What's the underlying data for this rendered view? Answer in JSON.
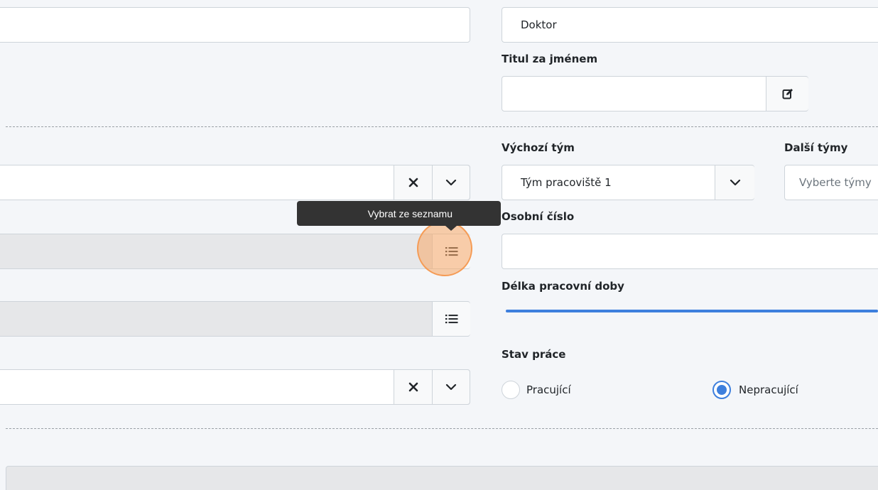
{
  "form": {
    "degree_before_value": "Doktor",
    "degree_after_label": "Titul za jménem",
    "degree_after_value": "",
    "default_team_label": "Výchozí tým",
    "default_team_value": "Tým pracoviště 1",
    "other_teams_label": "Další týmy",
    "other_teams_placeholder": "Vyberte týmy",
    "personal_number_label": "Osobní číslo",
    "personal_number_value": "",
    "work_length_label": "Délka pracovní doby",
    "work_length_fill_percent": 100,
    "work_status_label": "Stav práce",
    "work_status_options": [
      "Pracující",
      "Nepracující"
    ],
    "work_status_selected": "Nepracující"
  },
  "tooltip": {
    "text": "Vybrat ze seznamu"
  },
  "colors": {
    "accent": "#3d7fdd",
    "highlight": "#f59b55",
    "tooltip_bg": "#333333"
  },
  "icons": {
    "edit": "edit-icon",
    "clear": "close-icon",
    "dropdown": "chevron-down-icon",
    "list": "list-icon"
  }
}
